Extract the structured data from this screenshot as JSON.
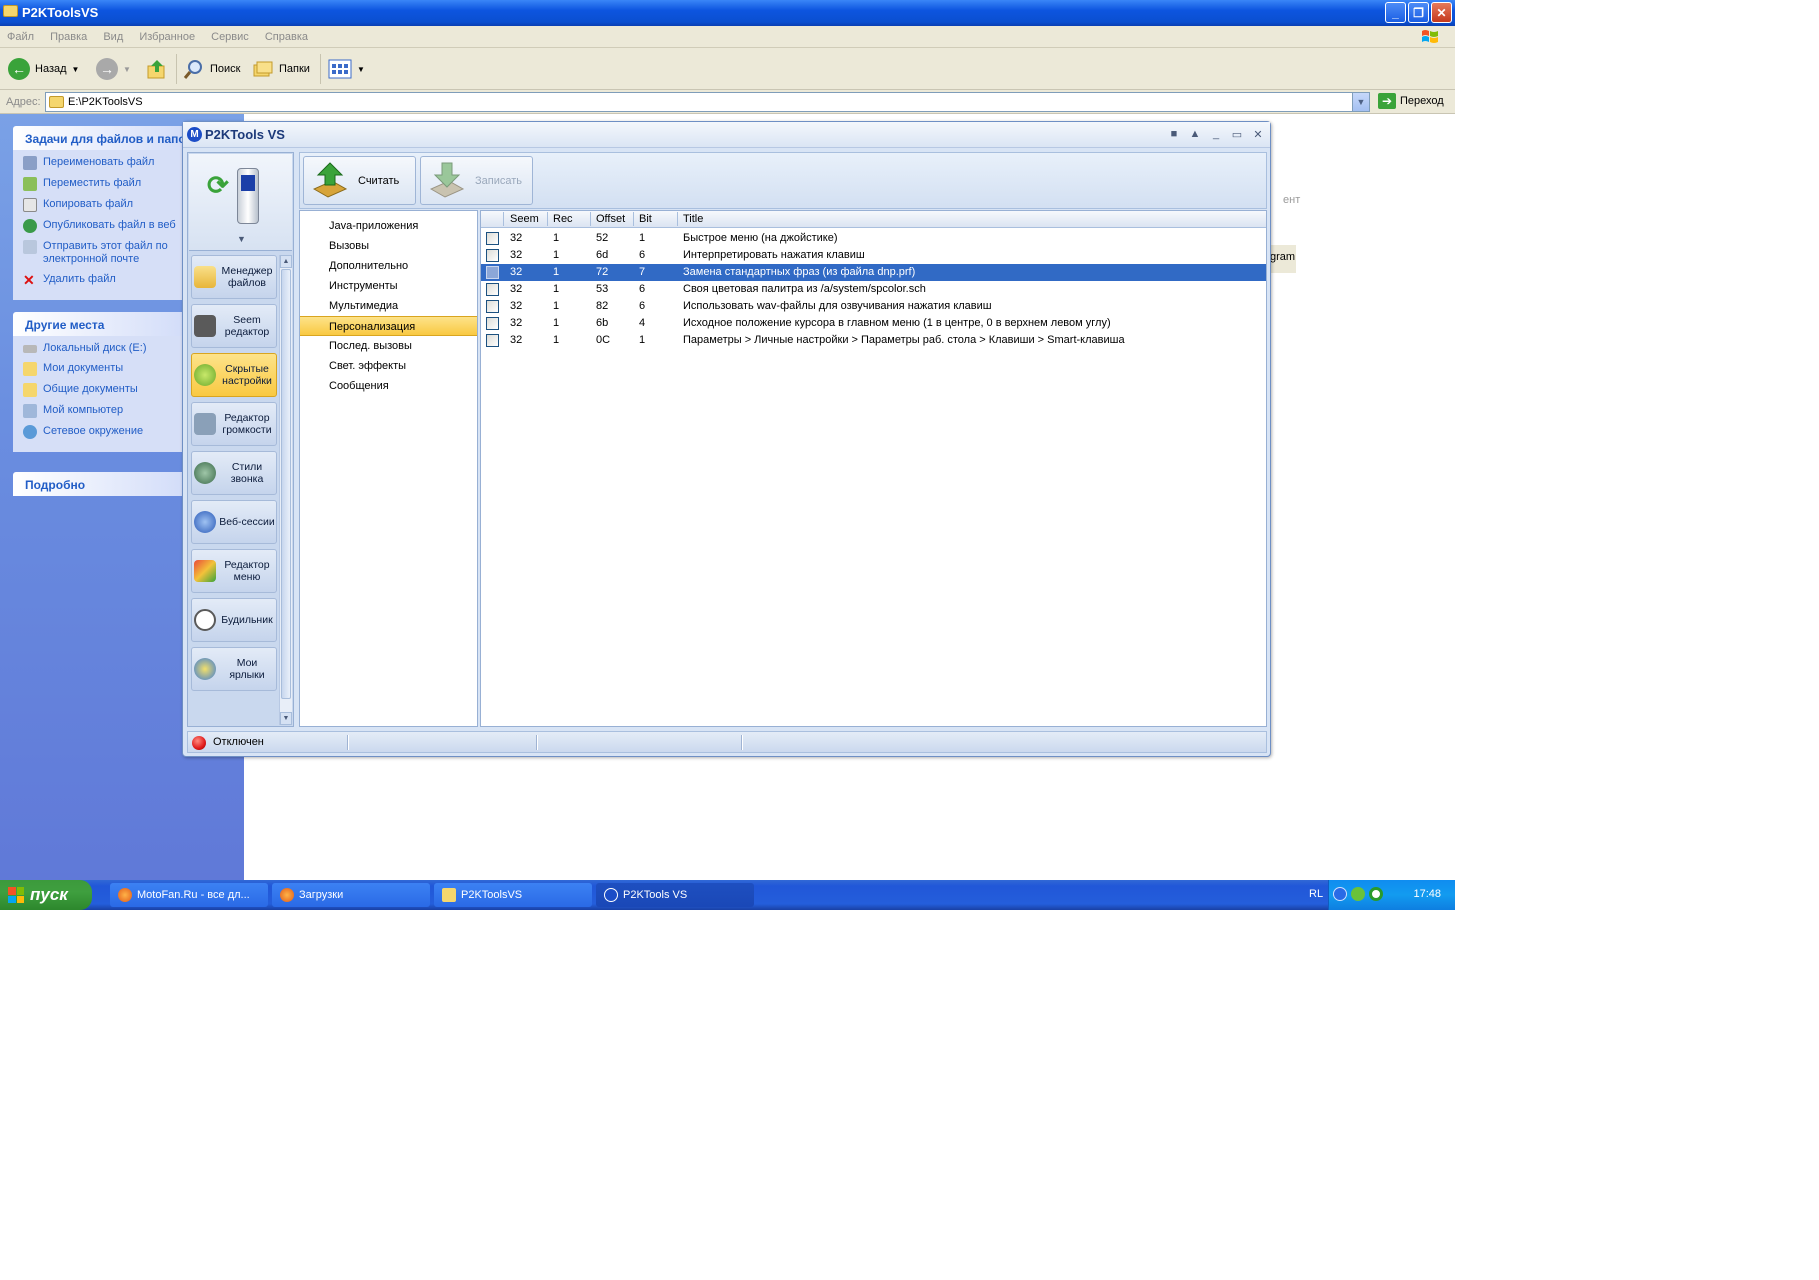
{
  "explorer": {
    "title": "P2KToolsVS",
    "menu": [
      "Файл",
      "Правка",
      "Вид",
      "Избранное",
      "Сервис",
      "Справка"
    ],
    "toolbar": {
      "back_label": "Назад",
      "search_label": "Поиск",
      "folders_label": "Папки"
    },
    "address": {
      "label": "Адрес:",
      "value": "E:\\P2KToolsVS",
      "go_label": "Переход"
    },
    "tasks": {
      "header": "Задачи для файлов и папок",
      "items": [
        {
          "label": "Переименовать файл",
          "icon": "rename-icon"
        },
        {
          "label": "Переместить файл",
          "icon": "move-icon"
        },
        {
          "label": "Копировать файл",
          "icon": "copy-icon"
        },
        {
          "label": "Опубликовать файл в веб",
          "icon": "publish-web-icon"
        },
        {
          "label": "Отправить этот файл по электронной почте",
          "icon": "email-icon"
        },
        {
          "label": "Удалить файл",
          "icon": "delete-icon"
        }
      ]
    },
    "places": {
      "header": "Другие места",
      "items": [
        {
          "label": "Локальный диск (E:)",
          "icon": "drive-icon"
        },
        {
          "label": "Мои документы",
          "icon": "my-documents-icon"
        },
        {
          "label": "Общие документы",
          "icon": "shared-documents-icon"
        },
        {
          "label": "Мой компьютер",
          "icon": "my-computer-icon"
        },
        {
          "label": "Сетевое окружение",
          "icon": "network-icon"
        }
      ]
    },
    "details": {
      "header": "Подробно"
    },
    "content_fragments": [
      "ент",
      "gram"
    ]
  },
  "p2k": {
    "title": "P2KTools VS",
    "toolbar": {
      "read_label": "Считать",
      "write_label": "Записать"
    },
    "nav": [
      {
        "label": "Менеджер файлов",
        "icon": "file-manager-icon",
        "active": false
      },
      {
        "label": "Seem редактор",
        "icon": "seem-editor-icon",
        "active": false
      },
      {
        "label": "Скрытые настройки",
        "icon": "hidden-settings-icon",
        "active": true
      },
      {
        "label": "Редактор громкости",
        "icon": "volume-editor-icon",
        "active": false
      },
      {
        "label": "Стили звонка",
        "icon": "ring-styles-icon",
        "active": false
      },
      {
        "label": "Веб-сессии",
        "icon": "web-sessions-icon",
        "active": false
      },
      {
        "label": "Редактор меню",
        "icon": "menu-editor-icon",
        "active": false
      },
      {
        "label": "Будильник",
        "icon": "alarm-clock-icon",
        "active": false
      },
      {
        "label": "Мои ярлыки",
        "icon": "shortcuts-icon",
        "active": false
      }
    ],
    "categories": [
      {
        "label": "Java-приложения",
        "active": false
      },
      {
        "label": "Вызовы",
        "active": false
      },
      {
        "label": "Дополнительно",
        "active": false
      },
      {
        "label": "Инструменты",
        "active": false
      },
      {
        "label": "Мультимедиа",
        "active": false
      },
      {
        "label": "Персонализация",
        "active": true
      },
      {
        "label": "Послед. вызовы",
        "active": false
      },
      {
        "label": "Свет. эффекты",
        "active": false
      },
      {
        "label": "Сообщения",
        "active": false
      }
    ],
    "grid": {
      "columns": [
        "Seem",
        "Rec",
        "Offset",
        "Bit",
        "Title"
      ],
      "rows": [
        {
          "seem": "32",
          "rec": "1",
          "offset": "52",
          "bit": "1",
          "title": "Быстрое меню (на джойстике)",
          "selected": false
        },
        {
          "seem": "32",
          "rec": "1",
          "offset": "6d",
          "bit": "6",
          "title": "Интерпретировать нажатия клавиш",
          "selected": false
        },
        {
          "seem": "32",
          "rec": "1",
          "offset": "72",
          "bit": "7",
          "title": "Замена стандартных фраз (из файла dnp.prf)",
          "selected": true
        },
        {
          "seem": "32",
          "rec": "1",
          "offset": "53",
          "bit": "6",
          "title": "Своя цветовая палитра из /a/system/spcolor.sch",
          "selected": false
        },
        {
          "seem": "32",
          "rec": "1",
          "offset": "82",
          "bit": "6",
          "title": "Использовать wav-файлы для озвучивания нажатия клавиш",
          "selected": false
        },
        {
          "seem": "32",
          "rec": "1",
          "offset": "6b",
          "bit": "4",
          "title": "Исходное положение курсора в главном меню (1 в центре, 0 в верхнем левом углу)",
          "selected": false
        },
        {
          "seem": "32",
          "rec": "1",
          "offset": "0C",
          "bit": "1",
          "title": "Параметры > Личные настройки > Параметры раб. стола > Клавиши > Smart-клавиша",
          "selected": false
        }
      ]
    },
    "status": {
      "text": "Отключен",
      "color": "#e01a1a"
    }
  },
  "taskbar": {
    "start_label": "пуск",
    "tasks": [
      {
        "label": "MotoFan.Ru - все дл...",
        "icon": "firefox-icon",
        "active": false
      },
      {
        "label": "Загрузки",
        "icon": "firefox-icon",
        "active": false
      },
      {
        "label": "P2KToolsVS",
        "icon": "folder-icon",
        "active": false
      },
      {
        "label": "P2KTools VS",
        "icon": "p2k-app-icon",
        "active": true
      }
    ],
    "tray": {
      "lang": "RL",
      "clock": "17:48"
    }
  }
}
